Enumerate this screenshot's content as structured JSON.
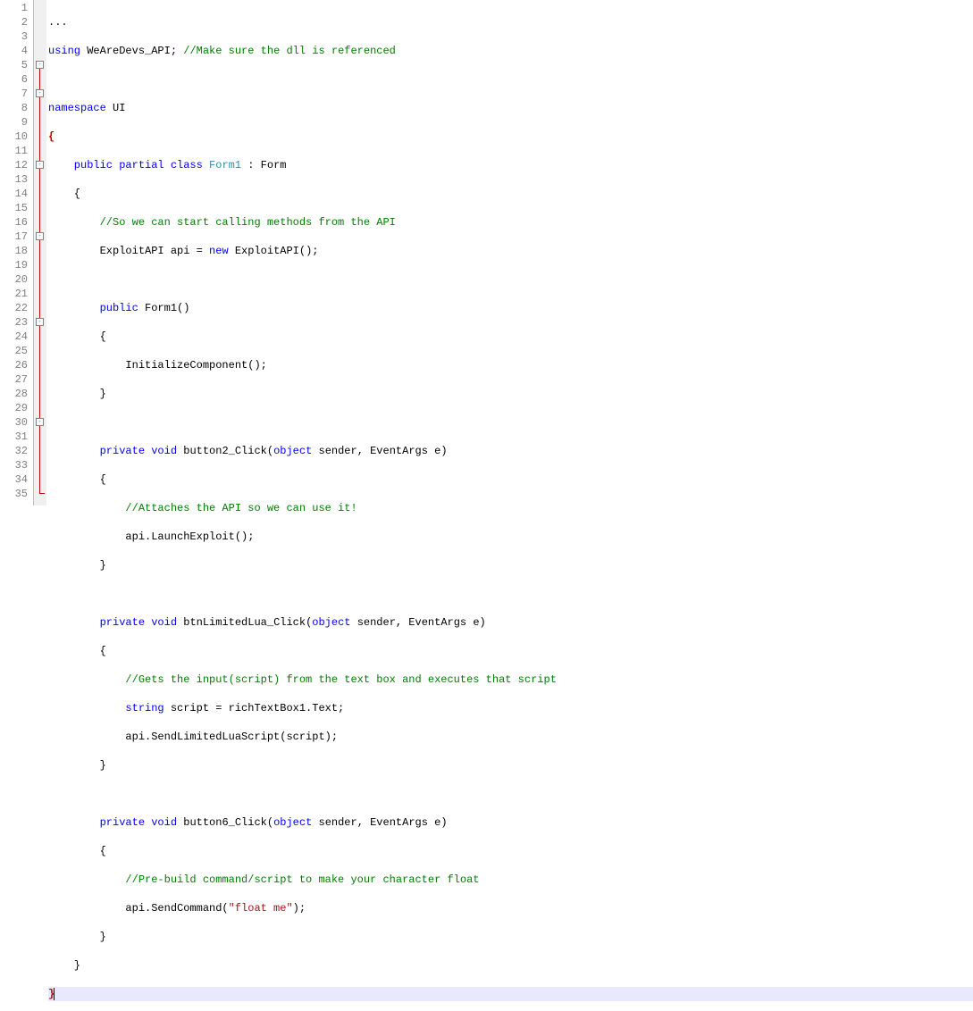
{
  "gutter": {
    "start": 1,
    "end": 35
  },
  "fold_markers": [
    {
      "line": 5,
      "symbol": "-"
    },
    {
      "line": 7,
      "symbol": "-"
    },
    {
      "line": 12,
      "symbol": "-"
    },
    {
      "line": 17,
      "symbol": "-"
    },
    {
      "line": 23,
      "symbol": "-"
    },
    {
      "line": 30,
      "symbol": "-"
    }
  ],
  "code": {
    "l1": "...",
    "l2_using": "using",
    "l2_ns": " WeAreDevs_API",
    "l2_semi": ";",
    "l2_cm": " //Make sure the dll is referenced",
    "l4_ns": "namespace",
    "l4_id": " UI",
    "l5": "{",
    "l6_pub": "    public",
    "l6_par": " partial",
    "l6_cls": " class",
    "l6_ty": " Form1",
    "l6_col": " : Form",
    "l7": "    {",
    "l8_cm": "        //So we can start calling methods from the API",
    "l9_ty": "        ExploitAPI",
    "l9_rest": " api = ",
    "l9_new": "new",
    "l9_ty2": " ExploitAPI",
    "l9_end": "();",
    "l11_pub": "        public",
    "l11_rest": " Form1()",
    "l12": "        {",
    "l13": "            InitializeComponent();",
    "l14": "        }",
    "l16_priv": "        private",
    "l16_void": " void",
    "l16_meth": " button2_Click(",
    "l16_obj": "object",
    "l16_rest": " sender, EventArgs e)",
    "l17": "        {",
    "l18_cm": "            //Attaches the API so we can use it!",
    "l19": "            api.LaunchExploit();",
    "l20": "        }",
    "l22_priv": "        private",
    "l22_void": " void",
    "l22_meth": " btnLimitedLua_Click(",
    "l22_obj": "object",
    "l22_rest": " sender, EventArgs e)",
    "l23": "        {",
    "l24_cm": "            //Gets the input(script) from the text box and executes that script",
    "l25_kw": "            string",
    "l25_rest": " script = richTextBox1.Text;",
    "l26": "            api.SendLimitedLuaScript(script);",
    "l27": "        }",
    "l29_priv": "        private",
    "l29_void": " void",
    "l29_meth": " button6_Click(",
    "l29_obj": "object",
    "l29_rest": " sender, EventArgs e)",
    "l30": "        {",
    "l31_cm": "            //Pre-build command/script to make your character float",
    "l32_a": "            api.SendCommand(",
    "l32_str": "\"float me\"",
    "l32_b": ");",
    "l33": "        }",
    "l34": "    }",
    "l35": "}"
  }
}
